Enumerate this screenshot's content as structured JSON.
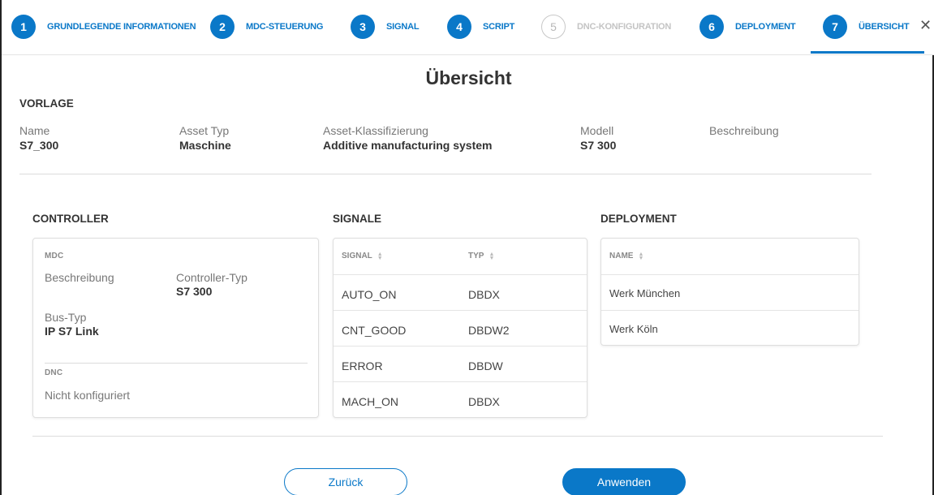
{
  "stepper": {
    "steps": [
      {
        "num": "1",
        "label": "GRUNDLEGENDE INFORMATIONEN",
        "state": "done"
      },
      {
        "num": "2",
        "label": "MDC-STEUERUNG",
        "state": "done"
      },
      {
        "num": "3",
        "label": "SIGNAL",
        "state": "done"
      },
      {
        "num": "4",
        "label": "SCRIPT",
        "state": "done"
      },
      {
        "num": "5",
        "label": "DNC-KONFIGURATION",
        "state": "disabled"
      },
      {
        "num": "6",
        "label": "DEPLOYMENT",
        "state": "done"
      },
      {
        "num": "7",
        "label": "ÜBERSICHT",
        "state": "active"
      }
    ],
    "close": "✕"
  },
  "page": {
    "title": "Übersicht"
  },
  "vorlage": {
    "heading": "VORLAGE",
    "fields": [
      {
        "label": "Name",
        "value": "S7_300"
      },
      {
        "label": "Asset Typ",
        "value": "Maschine"
      },
      {
        "label": "Asset-Klassifizierung",
        "value": "Additive manufacturing system"
      },
      {
        "label": "Modell",
        "value": "S7 300"
      },
      {
        "label": "Beschreibung",
        "value": ""
      }
    ]
  },
  "controller": {
    "heading": "CONTROLLER",
    "mdc_heading": "MDC",
    "beschreibung_label": "Beschreibung",
    "controller_typ_label": "Controller-Typ",
    "controller_typ_value": "S7 300",
    "bus_typ_label": "Bus-Typ",
    "bus_typ_value": "IP S7 Link",
    "dnc_heading": "DNC",
    "dnc_value": "Nicht konfiguriert"
  },
  "signale": {
    "heading": "SIGNALE",
    "columns": [
      "SIGNAL",
      "TYP"
    ],
    "rows": [
      [
        "AUTO_ON",
        "DBDX"
      ],
      [
        "CNT_GOOD",
        "DBDW2"
      ],
      [
        "ERROR",
        "DBDW"
      ],
      [
        "MACH_ON",
        "DBDX"
      ]
    ]
  },
  "deployment": {
    "heading": "DEPLOYMENT",
    "column": "NAME",
    "rows": [
      "Werk München",
      "Werk Köln"
    ]
  },
  "buttons": {
    "back": "Zurück",
    "apply": "Anwenden"
  },
  "colors": {
    "accent": "#0a78c8",
    "disabled": "#c4c4c4"
  },
  "icons": {
    "sort": "sort-icon",
    "close": "close-icon"
  }
}
